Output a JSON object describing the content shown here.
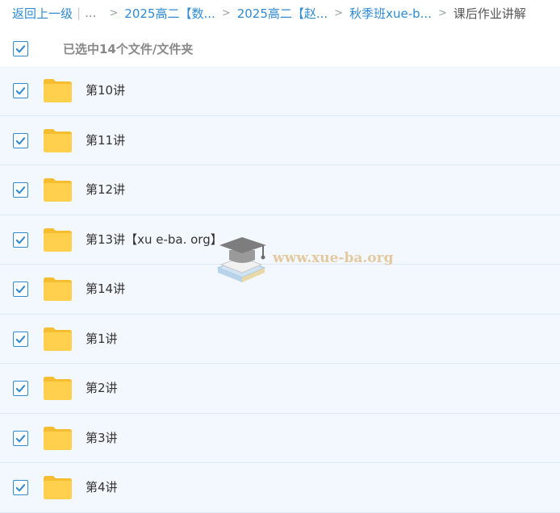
{
  "breadcrumb": {
    "back": "返回上一级",
    "separator": "|",
    "ellipsis": "...",
    "items": [
      "2025高二【数...",
      "2025高二【赵...",
      "秋季班xue-b..."
    ],
    "current": "课后作业讲解"
  },
  "selection": {
    "text": "已选中14个文件/文件夹",
    "checked": true
  },
  "files": [
    {
      "name": "第10讲",
      "type": "folder",
      "checked": true
    },
    {
      "name": "第11讲",
      "type": "folder",
      "checked": true
    },
    {
      "name": "第12讲",
      "type": "folder",
      "checked": true
    },
    {
      "name": "第13讲【xu e-ba. org】",
      "type": "folder",
      "checked": true
    },
    {
      "name": "第14讲",
      "type": "folder",
      "checked": true
    },
    {
      "name": "第1讲",
      "type": "folder",
      "checked": true
    },
    {
      "name": "第2讲",
      "type": "folder",
      "checked": true
    },
    {
      "name": "第3讲",
      "type": "folder",
      "checked": true
    },
    {
      "name": "第4讲",
      "type": "folder",
      "checked": true
    }
  ],
  "watermark": {
    "text": "www.xue-ba.org",
    "icon": "graduation-cap-books-icon"
  },
  "colors": {
    "accent": "#2f8ad1",
    "row_bg": "#f2f8fd",
    "folder": "#ffd04d"
  }
}
